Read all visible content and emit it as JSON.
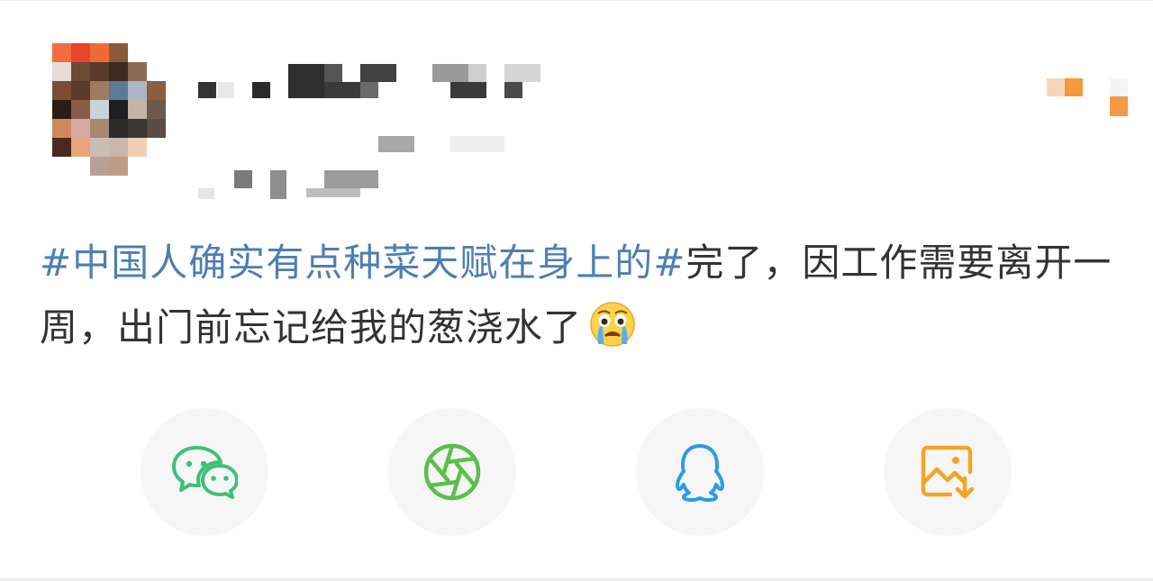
{
  "post": {
    "topic": "#中国人确实有点种菜天赋在身上的#",
    "body": "完了，因工作需要离开一周，出门前忘记给我的葱浇水了",
    "emoji": "crying-face-emoji"
  },
  "share": [
    {
      "name": "wechat",
      "icon": "wechat-icon",
      "color": "#3cc07a"
    },
    {
      "name": "moments",
      "icon": "camera-shutter-icon",
      "color": "#5ac04a"
    },
    {
      "name": "qq",
      "icon": "qq-penguin-icon",
      "color": "#2a9ce6"
    },
    {
      "name": "save-image",
      "icon": "image-download-icon",
      "color": "#f4a524"
    }
  ],
  "colors": {
    "topic": "#4d7fb2",
    "text": "#333333",
    "button_bg": "#f6f6f6"
  }
}
